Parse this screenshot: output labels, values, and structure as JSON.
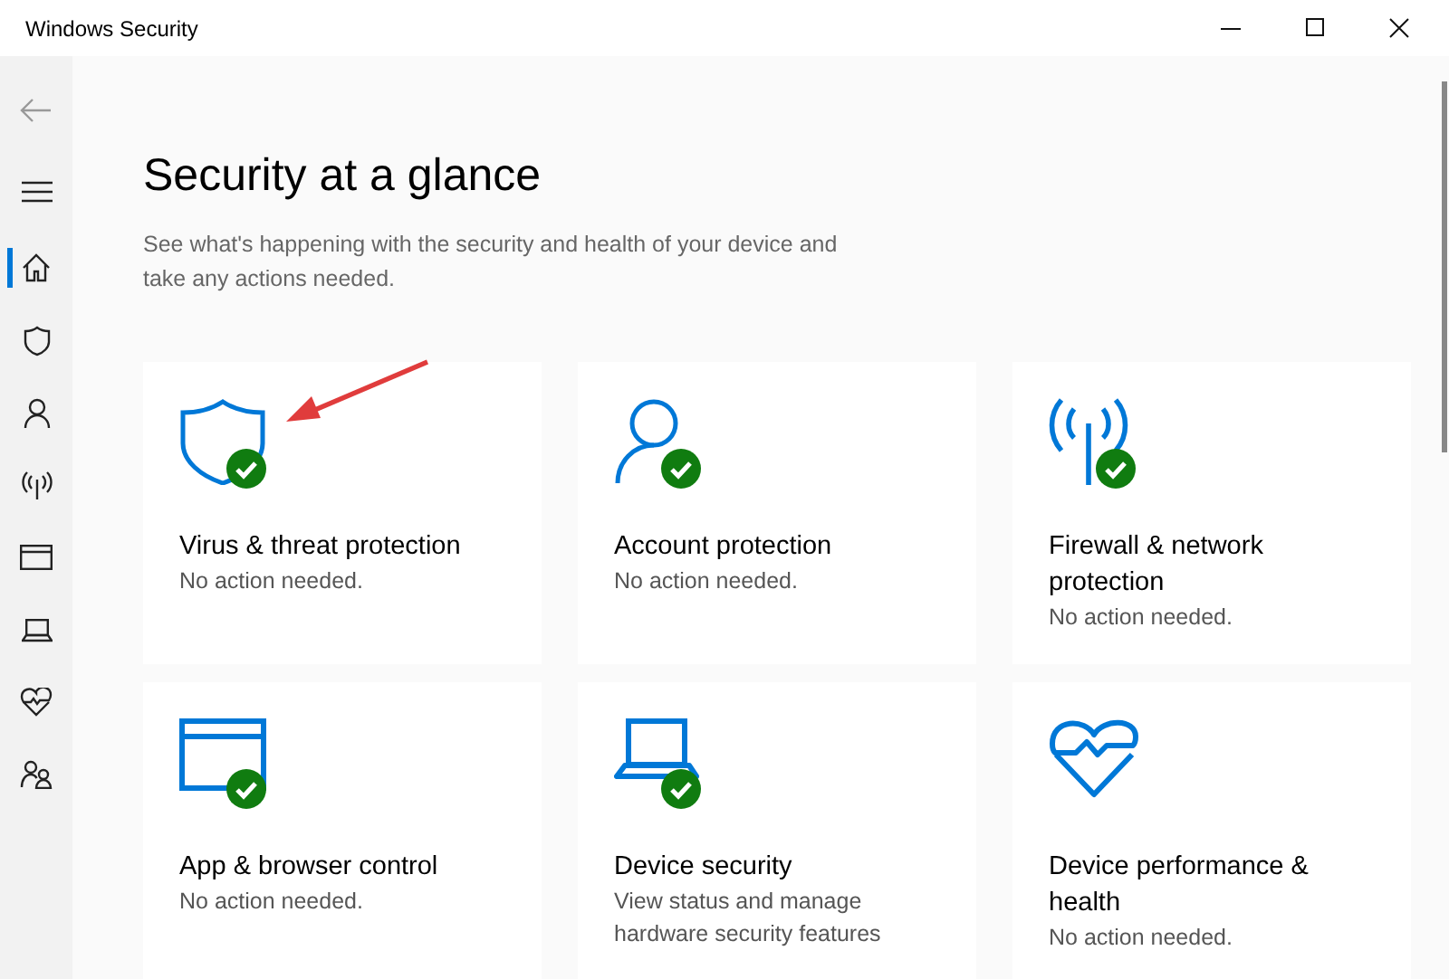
{
  "window": {
    "title": "Windows Security"
  },
  "sidebar": {
    "items": [
      {
        "kind": "back",
        "selected": false
      },
      {
        "kind": "menu",
        "selected": false
      },
      {
        "kind": "home",
        "selected": true
      },
      {
        "kind": "shield",
        "selected": false
      },
      {
        "kind": "person",
        "selected": false
      },
      {
        "kind": "antenna",
        "selected": false
      },
      {
        "kind": "browser",
        "selected": false
      },
      {
        "kind": "laptop",
        "selected": false
      },
      {
        "kind": "heart",
        "selected": false
      },
      {
        "kind": "family",
        "selected": false
      }
    ]
  },
  "page": {
    "title": "Security at a glance",
    "subtitle": "See what's happening with the security and health of your device and take any actions needed."
  },
  "cards": [
    {
      "kind": "shield",
      "title": "Virus & threat protection",
      "status": "No action needed.",
      "checked": true,
      "pointed": true
    },
    {
      "kind": "person",
      "title": "Account protection",
      "status": "No action needed.",
      "checked": true,
      "pointed": false
    },
    {
      "kind": "antenna",
      "title": "Firewall & network protection",
      "status": "No action needed.",
      "checked": true,
      "pointed": false
    },
    {
      "kind": "browser",
      "title": "App & browser control",
      "status": "No action needed.",
      "checked": true,
      "pointed": false
    },
    {
      "kind": "laptop",
      "title": "Device security",
      "status": "View status and manage hardware security features",
      "checked": true,
      "pointed": false
    },
    {
      "kind": "heart",
      "title": "Device performance & health",
      "status": "No action needed.",
      "checked": false,
      "pointed": false
    }
  ]
}
